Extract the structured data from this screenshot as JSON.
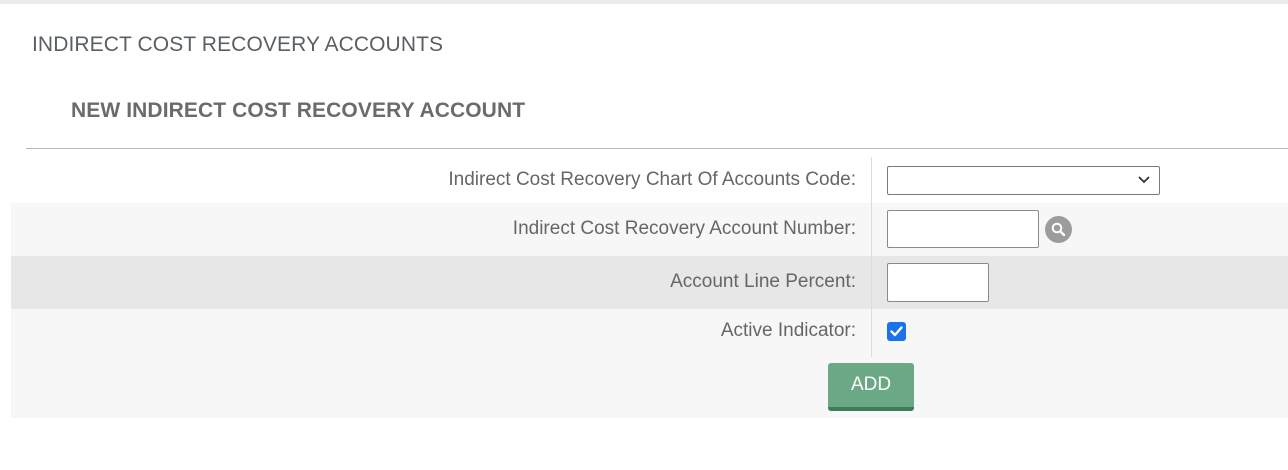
{
  "page": {
    "section_title": "INDIRECT COST RECOVERY ACCOUNTS",
    "subsection_title": "NEW INDIRECT COST RECOVERY ACCOUNT"
  },
  "form": {
    "chart_code": {
      "label": "Indirect Cost Recovery Chart Of Accounts Code:",
      "value": ""
    },
    "account_number": {
      "label": "Indirect Cost Recovery Account Number:",
      "value": "",
      "lookup_icon": "search-icon"
    },
    "line_percent": {
      "label": "Account Line Percent:",
      "value": ""
    },
    "active_indicator": {
      "label": "Active Indicator:",
      "checked": true
    }
  },
  "actions": {
    "add_label": "ADD"
  },
  "colors": {
    "add_button": "#6aa886",
    "checkbox": "#1a73e8",
    "row_highlight": "#e7e7e7"
  }
}
